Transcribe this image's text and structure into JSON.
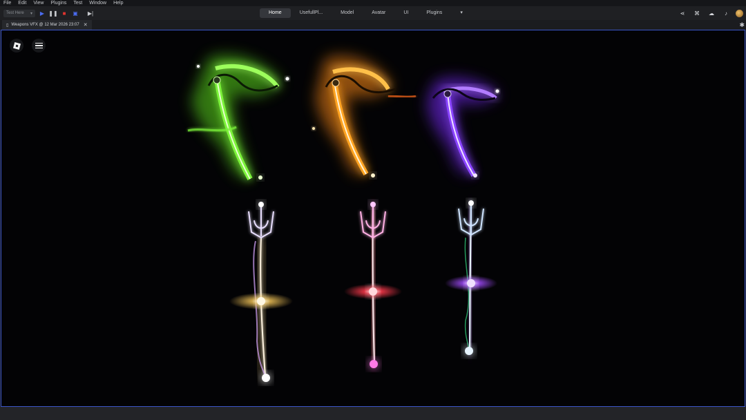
{
  "menubar": {
    "items": [
      "File",
      "Edit",
      "View",
      "Plugins",
      "Test",
      "Window",
      "Help"
    ]
  },
  "toolbar": {
    "test_dropdown": "Test Here",
    "tabs": [
      "Home",
      "UsefullPl...",
      "Model",
      "Avatar",
      "UI",
      "Plugins"
    ],
    "active_tab": "Home"
  },
  "document": {
    "tab_label": "Weapons VFX @ 12 Mar 2026 23:07"
  },
  "icons": [
    "roblox-logo-icon",
    "hamburger-menu-icon",
    "play-icon",
    "pause-icon",
    "stop-icon",
    "share-icon",
    "cloud-icon",
    "bell-icon",
    "gear-icon",
    "close-icon"
  ],
  "colors": {
    "accent_border": "#3b55c9",
    "scythe_green": "#6cf02a",
    "scythe_orange": "#ff9a1f",
    "scythe_purple": "#8a3cff",
    "trident_gold": "#f7d27a",
    "trident_red": "#ff3a4c",
    "trident_violet": "#b54cff"
  }
}
